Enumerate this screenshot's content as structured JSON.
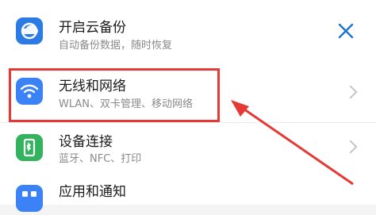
{
  "settings": {
    "backup": {
      "title": "开启云备份",
      "subtitle": "自动备份数据，随时恢复",
      "icon": "cloud-backup-icon",
      "icon_color": "#2c7be5"
    },
    "wireless": {
      "title": "无线和网络",
      "subtitle": "WLAN、双卡管理、移动网络",
      "icon": "wifi-icon",
      "icon_color": "#3b82f6"
    },
    "device_connection": {
      "title": "设备连接",
      "subtitle": "蓝牙、NFC、打印",
      "icon": "device-connection-icon",
      "icon_color": "#33b35e"
    },
    "apps_notifications": {
      "title": "应用和通知",
      "icon": "apps-icon",
      "icon_color": "#3b82f6"
    }
  },
  "annotation_color": "#e53935",
  "accent_color": "#1976d2"
}
